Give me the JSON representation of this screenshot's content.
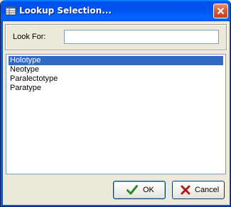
{
  "window": {
    "title": "Lookup Selection..."
  },
  "search": {
    "label": "Look For:",
    "value": "",
    "placeholder": ""
  },
  "list": {
    "items": [
      "Holotype",
      "Neotype",
      "Paralectotype",
      "Paratype"
    ],
    "selected_index": 0
  },
  "buttons": {
    "ok": {
      "label": "OK",
      "icon": "checkmark-icon"
    },
    "cancel": {
      "label": "Cancel",
      "icon": "x-icon"
    }
  },
  "colors": {
    "titlebar": "#0054e3",
    "selection": "#316ac5",
    "ok_check": "#2a8a2a",
    "cancel_x": "#b01818",
    "close_button": "#d95c34"
  }
}
